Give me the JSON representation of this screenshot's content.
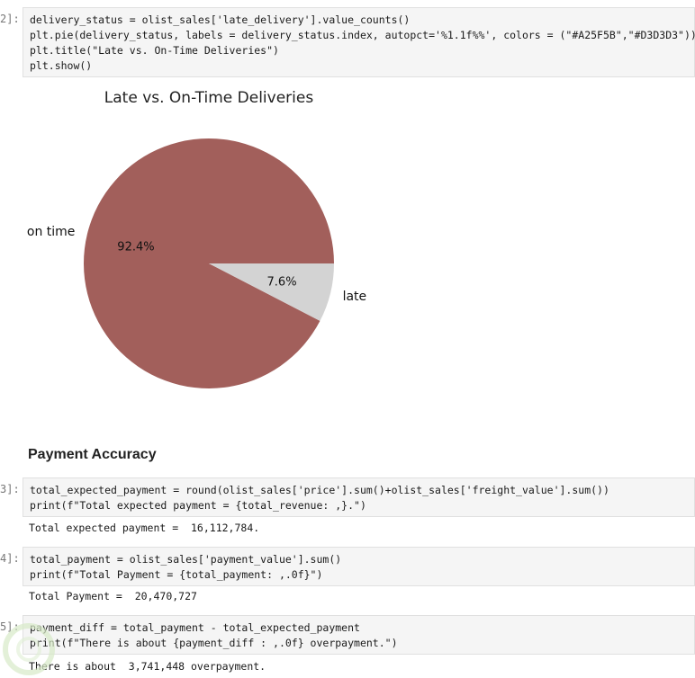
{
  "cells": [
    {
      "prompt": "2]:",
      "lines": [
        "delivery_status = olist_sales['late_delivery'].value_counts()",
        "plt.pie(delivery_status, labels = delivery_status.index, autopct='%1.1f%%', colors = (\"#A25F5B\",\"#D3D3D3\"))",
        "plt.title(\"Late vs. On-Time Deliveries\")",
        "plt.show()"
      ]
    },
    {
      "prompt": "3]:",
      "lines": [
        "total_expected_payment = round(olist_sales['price'].sum()+olist_sales['freight_value'].sum())",
        "print(f\"Total expected payment = {total_revenue: ,}.\")"
      ],
      "output": "Total expected payment =  16,112,784."
    },
    {
      "prompt": "4]:",
      "lines": [
        "total_payment = olist_sales['payment_value'].sum()",
        "print(f\"Total Payment = {total_payment: ,.0f}\")"
      ],
      "output": "Total Payment =  20,470,727"
    },
    {
      "prompt": "5]:",
      "lines": [
        "payment_diff = total_payment - total_expected_payment",
        "print(f\"There is about {payment_diff : ,.0f} overpayment.\")"
      ],
      "output": "There is about  3,741,448 overpayment."
    }
  ],
  "markdown_heading": "Payment Accuracy",
  "chart_data": {
    "type": "pie",
    "title": "Late vs. On-Time Deliveries",
    "categories": [
      "on time",
      "late"
    ],
    "values": [
      92.4,
      7.6
    ],
    "value_labels": [
      "92.4%",
      "7.6%"
    ],
    "colors": [
      "#A25F5B",
      "#D3D3D3"
    ],
    "start_angle_deg": 0,
    "direction": "counterclockwise"
  },
  "colors": {
    "cell_bg": "#f5f5f5",
    "cell_border": "#e0e0e0",
    "string": "#a31515"
  }
}
